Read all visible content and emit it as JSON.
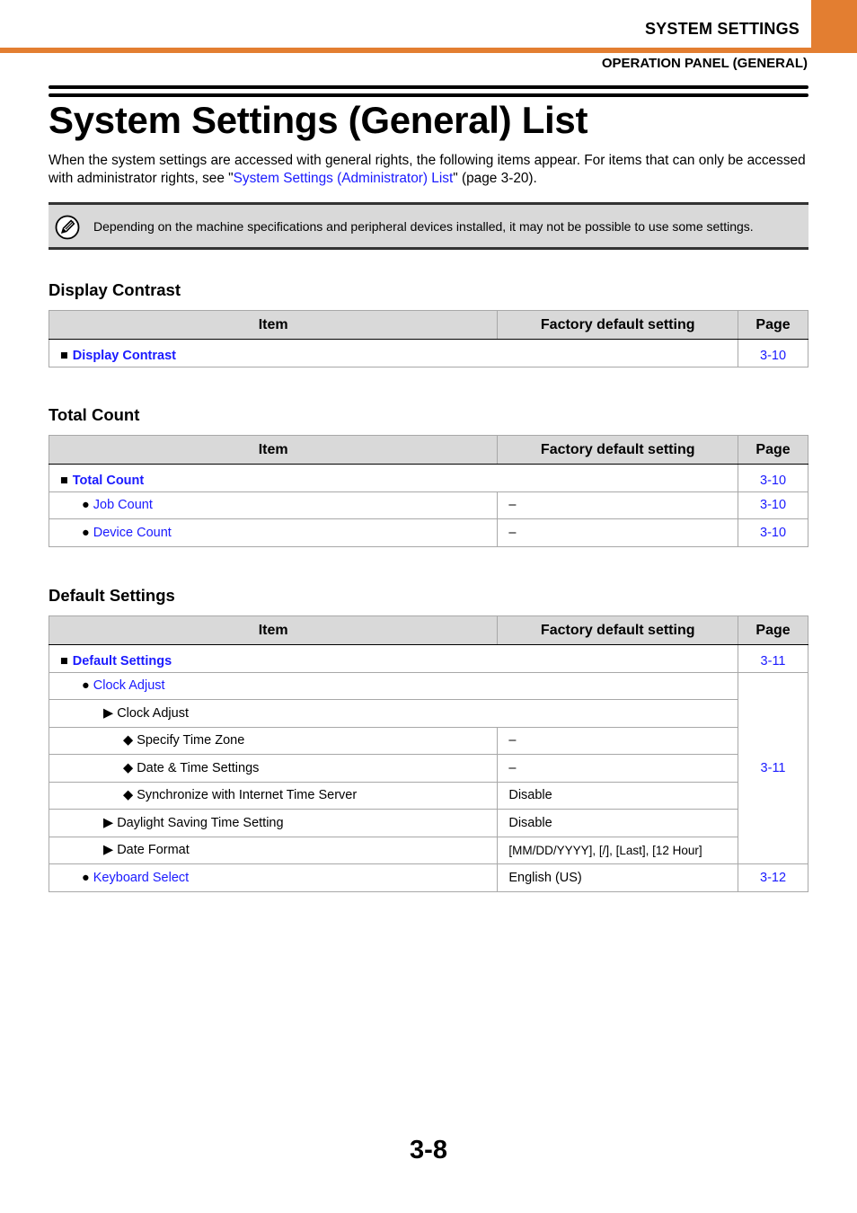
{
  "header": {
    "chapter": "SYSTEM SETTINGS",
    "section": "OPERATION PANEL (GENERAL)",
    "accent_color": "#e37e31"
  },
  "title": "System Settings (General) List",
  "intro": {
    "text_before": "When the system settings are accessed with general rights, the following items appear. For items that can only be accessed with administrator rights, see \"",
    "link": "System Settings (Administrator) List",
    "text_after": "\" (page 3-20)."
  },
  "note": {
    "icon": "pencil-note-icon",
    "text": "Depending on the machine specifications and peripheral devices installed, it may not be possible to use some settings."
  },
  "columns": {
    "item": "Item",
    "default": "Factory default setting",
    "page": "Page"
  },
  "bullets": {
    "square": "■",
    "circle": "●",
    "triangle": "▶",
    "diamond": "◆"
  },
  "sections": [
    {
      "heading": "Display Contrast",
      "rows": [
        {
          "level": 1,
          "item": "Display Contrast",
          "page": "3-10"
        }
      ]
    },
    {
      "heading": "Total Count",
      "rows": [
        {
          "level": 1,
          "item": "Total Count",
          "page": "3-10"
        },
        {
          "level": 2,
          "item": "Job Count",
          "default": "–",
          "page": "3-10"
        },
        {
          "level": 2,
          "item": "Device Count",
          "default": "–",
          "page": "3-10"
        }
      ]
    },
    {
      "heading": "Default Settings",
      "rows": [
        {
          "level": 1,
          "item": "Default Settings",
          "page": "3-11"
        },
        {
          "level": 2,
          "item": "Clock Adjust",
          "page": "3-11"
        },
        {
          "level": 3,
          "item": "Clock Adjust"
        },
        {
          "level": 4,
          "item": "Specify Time Zone",
          "default": "–"
        },
        {
          "level": 4,
          "item": "Date & Time Settings",
          "default": "–"
        },
        {
          "level": 4,
          "item": "Synchronize with Internet Time Server",
          "default": "Disable"
        },
        {
          "level": 3,
          "item": "Daylight Saving Time Setting",
          "default": "Disable"
        },
        {
          "level": 3,
          "item": "Date Format",
          "default": "[MM/DD/YYYY], [/], [Last], [12 Hour]"
        },
        {
          "level": 2,
          "item": "Keyboard Select",
          "default": "English (US)",
          "page": "3-12"
        }
      ]
    }
  ],
  "page_number": "3-8"
}
